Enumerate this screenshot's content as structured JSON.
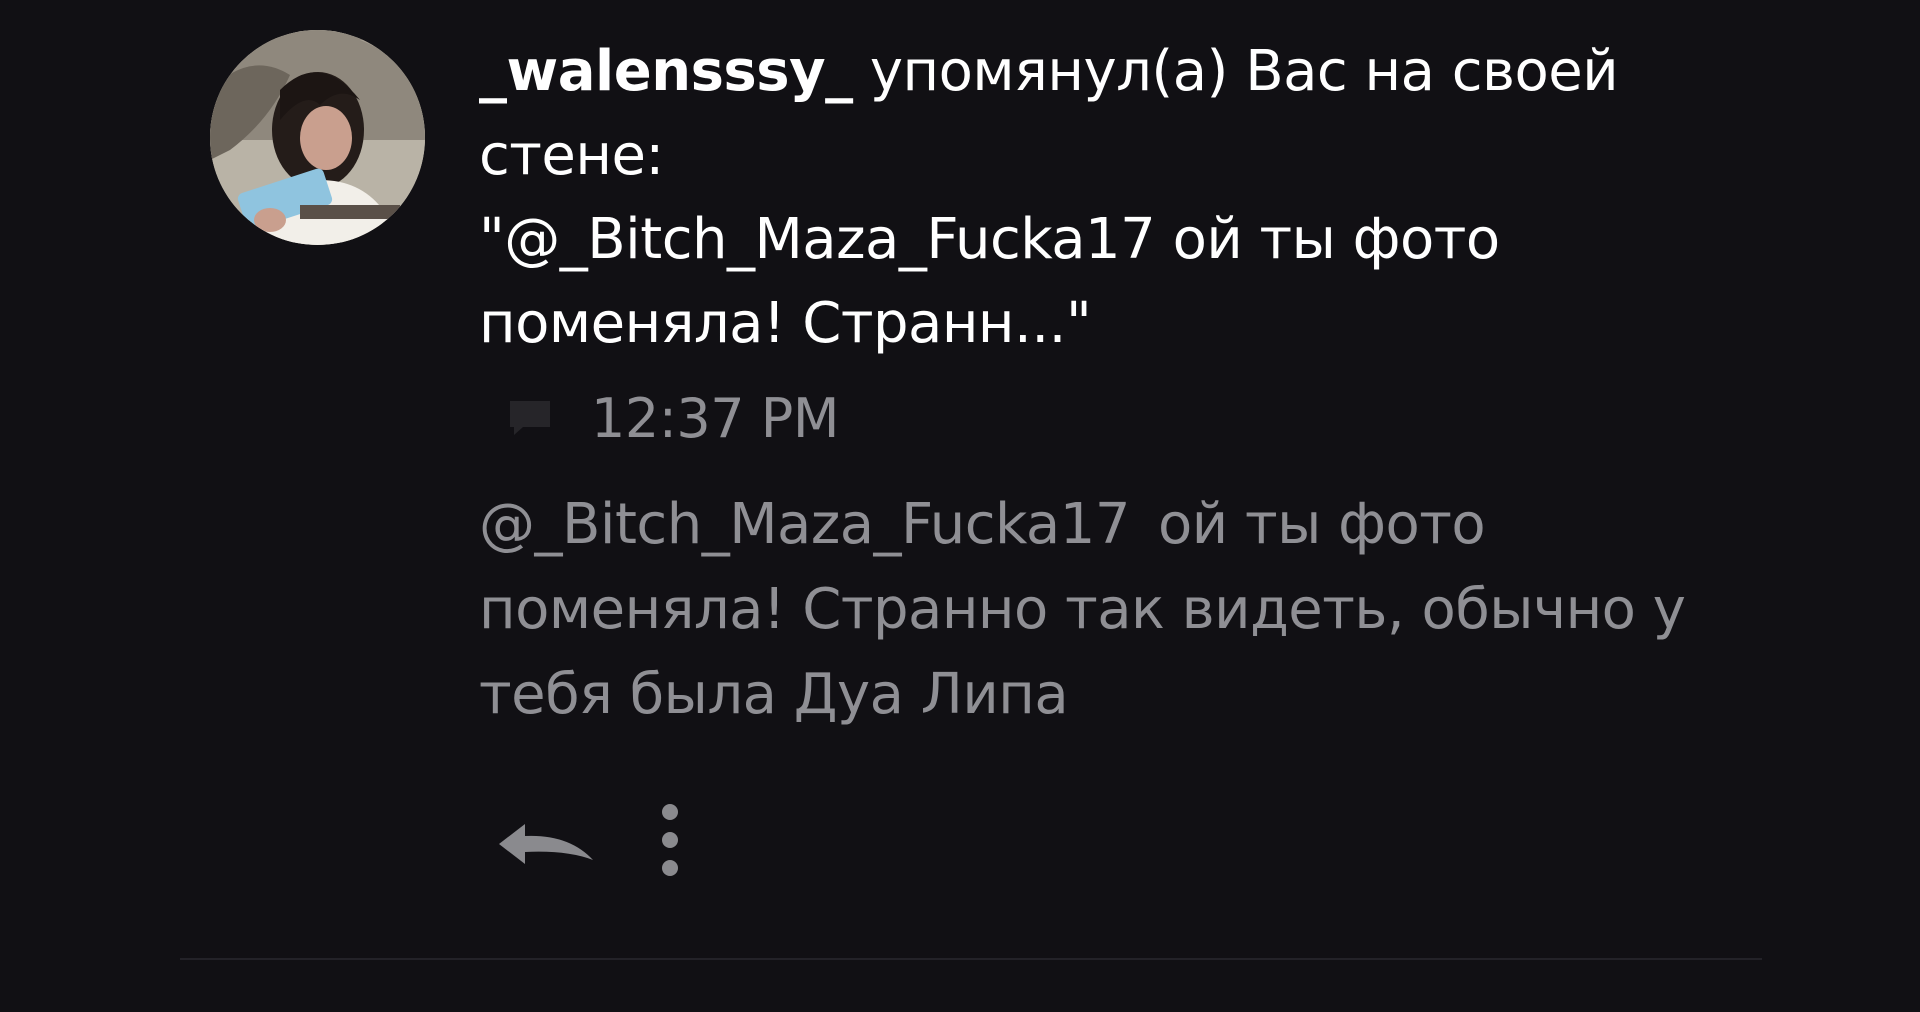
{
  "notification": {
    "username": "_walensssy_",
    "action_text": " упомянул(а) Вас на своей стене:",
    "quoted_text": "\"@_Bitch_Maza_Fucka17 ой ты фото поменяла! Странн...\"",
    "timestamp": "12:37 PM",
    "comment_mention": "@_Bitch_Maza_Fucka17",
    "comment_text": "ой ты фото поменяла! Странно так видеть, обычно у тебя была Дуа Липа"
  },
  "icons": {
    "avatar": "user-avatar-photo",
    "comment": "comment-icon",
    "reply": "reply-icon",
    "more": "more-vertical-icon"
  },
  "colors": {
    "background": "#111014",
    "primary_text": "#ffffff",
    "secondary_text": "#8f8f94",
    "divider": "#232228"
  }
}
